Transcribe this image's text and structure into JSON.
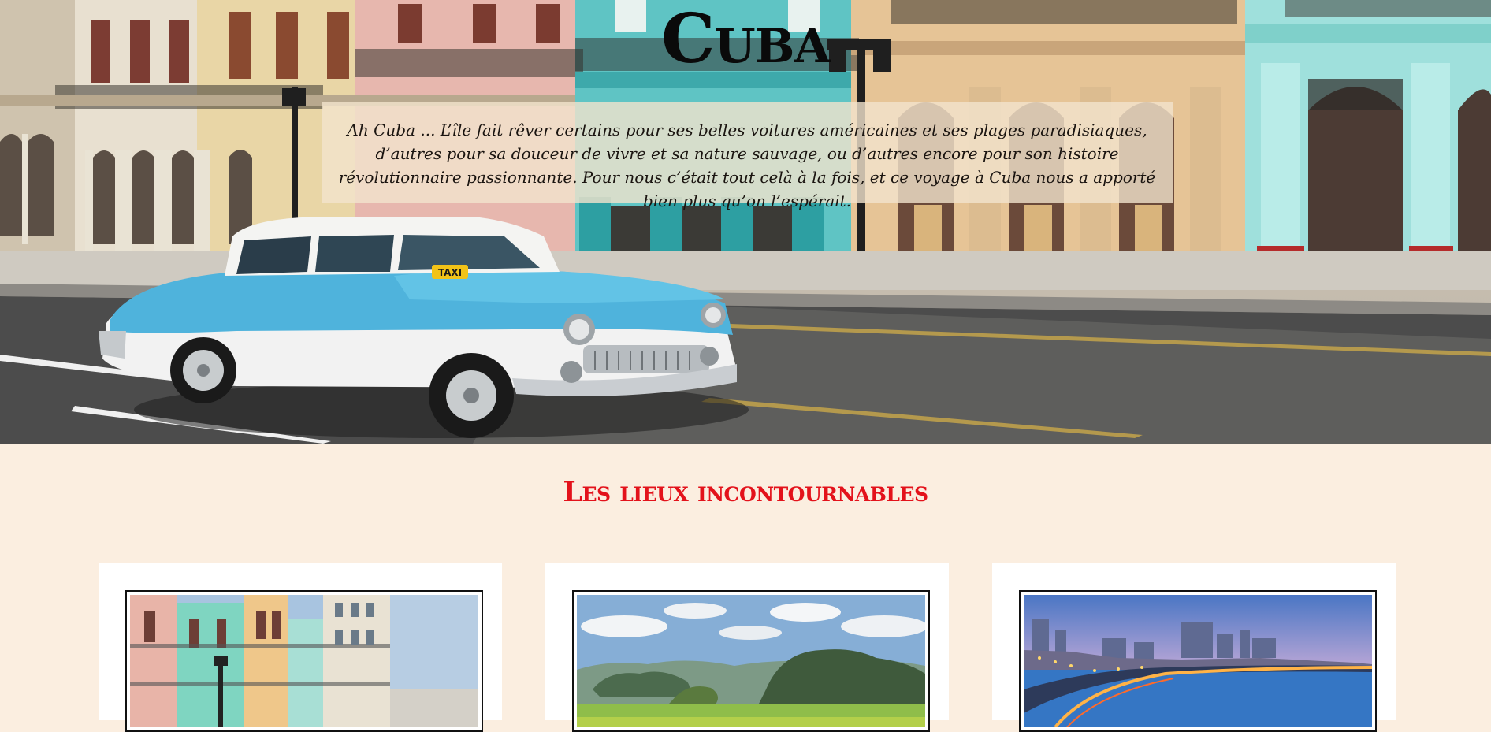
{
  "hero": {
    "title": "Cuba",
    "intro": "Ah Cuba ... L’île fait rêver certains pour ses belles voitures américaines et ses plages paradisiaques, d’autres pour sa douceur de vivre et sa nature sauvage, ou d’autres encore pour son histoire révolutionnaire passionnante. Pour nous c’était tout celà à la fois, et ce voyage à Cuba nous a apporté bien plus qu’on l’espérait.",
    "taxi_sign": "TAXI"
  },
  "section": {
    "title": "Les lieux incontournables"
  },
  "cards": [
    {
      "image": "havana-colorful-buildings"
    },
    {
      "image": "vinales-valley-mogotes"
    },
    {
      "image": "havana-malecon-night"
    }
  ]
}
